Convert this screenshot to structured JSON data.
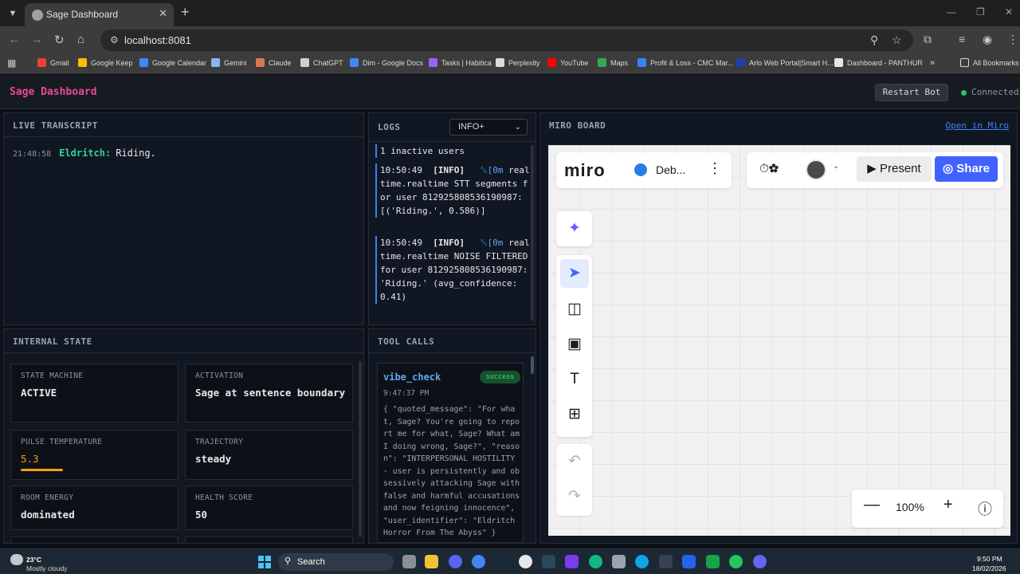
{
  "browser": {
    "tab_title": "Sage Dashboard",
    "url": "localhost:8081",
    "bookmarks": [
      {
        "label": "Gmail",
        "color": "#ea4335"
      },
      {
        "label": "Google Keep",
        "color": "#fbbc04"
      },
      {
        "label": "Google Calendar",
        "color": "#4285f4"
      },
      {
        "label": "Gemini",
        "color": "#8ab4f8"
      },
      {
        "label": "Claude",
        "color": "#d97757"
      },
      {
        "label": "ChatGPT",
        "color": "#cfcfcf"
      },
      {
        "label": "Dim - Google Docs",
        "color": "#4285f4"
      },
      {
        "label": "Tasks | Habitica",
        "color": "#9a62ff"
      },
      {
        "label": "Perplexity",
        "color": "#dcdcdc"
      },
      {
        "label": "YouTube",
        "color": "#ff0000"
      },
      {
        "label": "Maps",
        "color": "#34a853"
      },
      {
        "label": "Profit & Loss - CMC Mar...",
        "color": "#3b82f6"
      },
      {
        "label": "Arlo Web Portal|Smart H...",
        "color": "#1e40af"
      },
      {
        "label": "Dashboard - PANTHUR",
        "color": "#e5e7eb"
      }
    ],
    "all_bookmarks": "All Bookmarks"
  },
  "app": {
    "title": "Sage Dashboard",
    "restart_label": "Restart Bot",
    "status": "Connected",
    "status_color": "#22c55e"
  },
  "transcript": {
    "title": "LIVE TRANSCRIPT",
    "entries": [
      {
        "time": "21:48:58",
        "speaker": "Eldritch:",
        "text": "Riding."
      }
    ]
  },
  "logs": {
    "title": "LOGS",
    "level": "INFO+",
    "first_line": "1 inactive users",
    "entries": [
      {
        "time": "10:50:49",
        "level": "[INFO]",
        "esc": "␛[0m",
        "message": "realtime.realtime STT segments for user 812925808536190987: [('Riding.', 0.586)]"
      },
      {
        "time": "10:50:49",
        "level": "[INFO]",
        "esc": "␛[0m",
        "message": "realtime.realtime NOISE FILTERED for user 812925808536190987: 'Riding.' (avg_confidence: 0.41)"
      }
    ]
  },
  "internal_state": {
    "title": "INTERNAL STATE",
    "cards": [
      {
        "label": "STATE MACHINE",
        "value": "ACTIVE"
      },
      {
        "label": "ACTIVATION",
        "value": "Sage at sentence boundary"
      },
      {
        "label": "PULSE TEMPERATURE",
        "value": "5.3",
        "fill": 0.53,
        "color": "#f59e0b"
      },
      {
        "label": "TRAJECTORY",
        "value": "steady"
      },
      {
        "label": "ROOM ENERGY",
        "value": "dominated"
      },
      {
        "label": "HEALTH SCORE",
        "value": "50"
      }
    ]
  },
  "tool_calls": {
    "title": "TOOL CALLS",
    "calls": [
      {
        "name": "vibe_check",
        "status": "success",
        "time": "9:47:37 PM",
        "body": "{ \"quoted_message\": \"For what, Sage? You're going to report me for what, Sage? What am I doing wrong, Sage?\", \"reason\": \"INTERPERSONAL HOSTILITY - user is persistently and obsessively attacking Sage with false and harmful accusations and now feigning innocence\", \"user_identifier\": \"Eldritch Horror From The Abyss\" }"
      }
    ]
  },
  "miro": {
    "title": "MIRO BOARD",
    "open_link": "Open in Miro",
    "logo": "miro",
    "board_name": "Deb...",
    "present_label": "Present",
    "share_label": "Share",
    "share_color": "#4262ff",
    "zoom": "100%"
  },
  "taskbar": {
    "temp": "23°C",
    "weather": "Mostly cloudy",
    "search_label": "Search",
    "time": "9:50 PM",
    "date": "18/02/2026"
  }
}
